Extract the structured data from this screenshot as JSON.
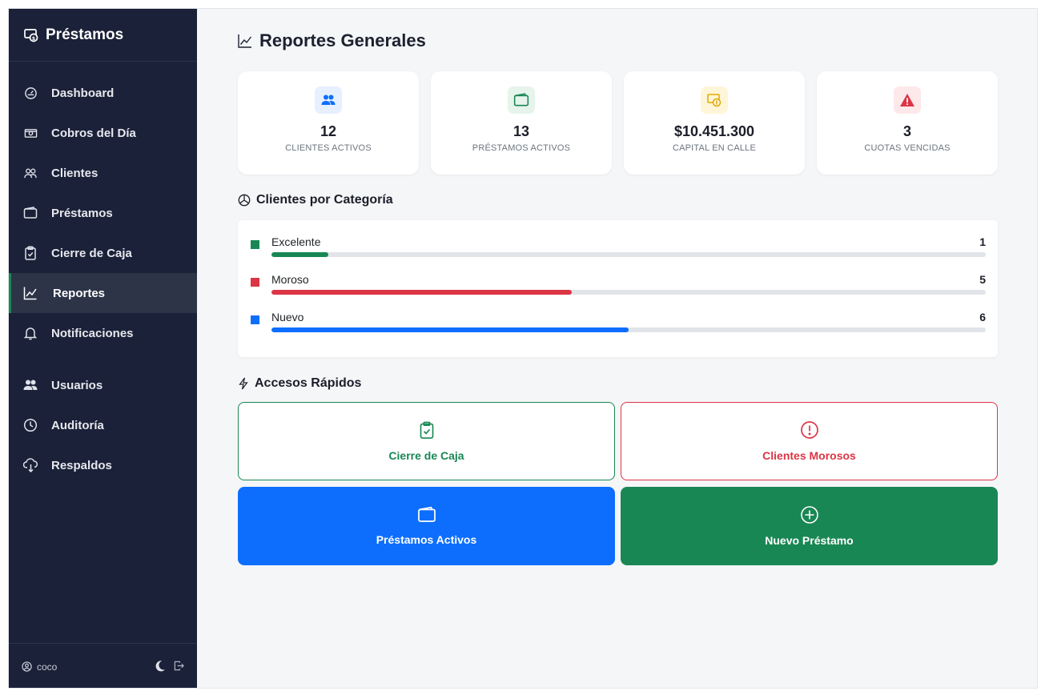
{
  "app": {
    "brand": "Préstamos"
  },
  "sidebar": {
    "items": [
      {
        "label": "Dashboard",
        "icon": "speedometer-icon"
      },
      {
        "label": "Cobros del Día",
        "icon": "cash-icon"
      },
      {
        "label": "Clientes",
        "icon": "people-icon"
      },
      {
        "label": "Préstamos",
        "icon": "wallet-icon"
      },
      {
        "label": "Cierre de Caja",
        "icon": "clipboard-check-icon"
      },
      {
        "label": "Reportes",
        "icon": "graph-up-icon",
        "active": true
      },
      {
        "label": "Notificaciones",
        "icon": "bell-icon"
      },
      {
        "label": "Usuarios",
        "icon": "people-fill-icon"
      },
      {
        "label": "Auditoría",
        "icon": "clock-history-icon"
      },
      {
        "label": "Respaldos",
        "icon": "cloud-download-icon"
      }
    ],
    "footer": {
      "user": "coco"
    }
  },
  "page": {
    "title": "Reportes Generales"
  },
  "stats": [
    {
      "value": "12",
      "label": "CLIENTES ACTIVOS",
      "color": "#0d6efd",
      "bg": "#e7f0ff"
    },
    {
      "value": "13",
      "label": "PRÉSTAMOS ACTIVOS",
      "color": "#198754",
      "bg": "#e6f4ec"
    },
    {
      "value": "$10.451.300",
      "label": "CAPITAL EN CALLE",
      "color": "#e0a800",
      "bg": "#fff6d9"
    },
    {
      "value": "3",
      "label": "CUOTAS VENCIDAS",
      "color": "#dc3545",
      "bg": "#fde8ea"
    }
  ],
  "categories": {
    "title": "Clientes por Categoría",
    "max": 12,
    "rows": [
      {
        "name": "Excelente",
        "count": 1,
        "color": "#198754"
      },
      {
        "name": "Moroso",
        "count": 5,
        "color": "#dc3545"
      },
      {
        "name": "Nuevo",
        "count": 6,
        "color": "#0d6efd"
      }
    ]
  },
  "quick": {
    "title": "Accesos Rápidos",
    "cierre_label": "Cierre de Caja",
    "morosos_label": "Clientes Morosos",
    "prestamos_label": "Préstamos Activos",
    "nuevo_label": "Nuevo Préstamo"
  }
}
